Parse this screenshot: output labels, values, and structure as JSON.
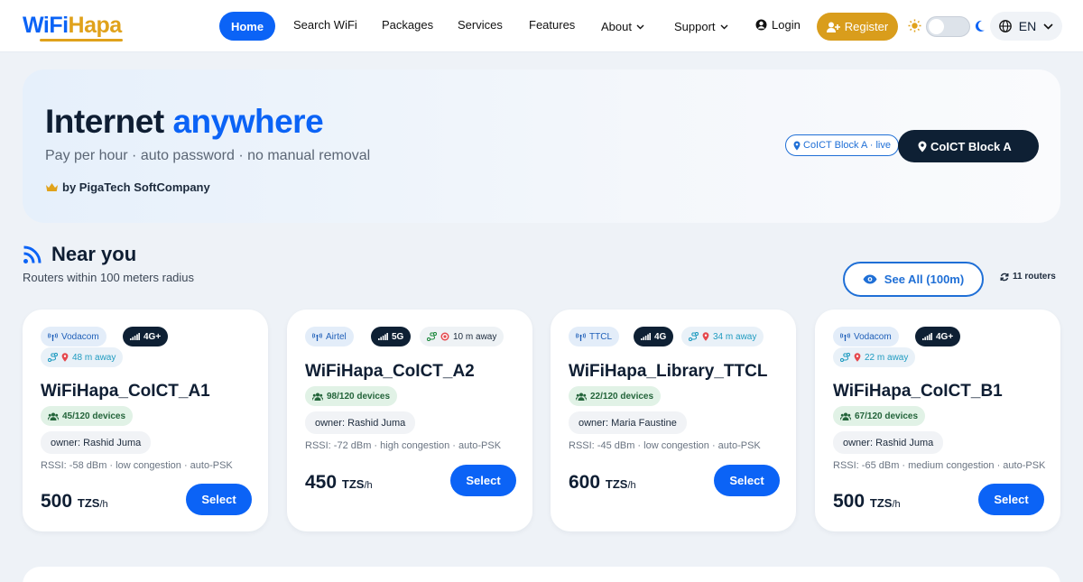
{
  "brand": {
    "logo_a": "WiFi",
    "logo_b": "Hapa"
  },
  "nav": {
    "home": "Home",
    "search": "Search WiFi",
    "packages": "Packages",
    "services": "Services",
    "features": "Features",
    "about": "About",
    "support": "Support",
    "login": "Login",
    "register": "Register",
    "language": "EN"
  },
  "hero": {
    "title_a": "Internet",
    "title_b": "anywhere",
    "subtitle": "Pay per hour · auto password · no manual removal",
    "by": "by PigaTech SoftCompany",
    "location_live": "CoICT Block A · live",
    "location_button": "CoICT Block A"
  },
  "near": {
    "title": "Near you",
    "subtitle": "Routers within 100 meters radius",
    "see_all": "See All (100m)",
    "count": "11 routers"
  },
  "routers": [
    {
      "operator": "Vodacom",
      "network": "4G+",
      "distance": "48 m away",
      "name": "WiFiHapa_CoICT_A1",
      "devices": "45/120 devices",
      "owner": "owner: Rashid Juma",
      "rssi": "RSSI: -58 dBm · low congestion · auto-PSK",
      "price": "500",
      "currency": "TZS",
      "per": "/h",
      "select": "Select"
    },
    {
      "operator": "Airtel",
      "network": "5G",
      "distance": "10 m away",
      "name": "WiFiHapa_CoICT_A2",
      "devices": "98/120 devices",
      "owner": "owner: Rashid Juma",
      "rssi": "RSSI: -72 dBm · high congestion · auto-PSK",
      "price": "450",
      "currency": "TZS",
      "per": "/h",
      "select": "Select"
    },
    {
      "operator": "TTCL",
      "network": "4G",
      "distance": "34 m away",
      "name": "WiFiHapa_Library_TTCL",
      "devices": "22/120 devices",
      "owner": "owner: Maria Faustine",
      "rssi": "RSSI: -45 dBm · low congestion · auto-PSK",
      "price": "600",
      "currency": "TZS",
      "per": "/h",
      "select": "Select"
    },
    {
      "operator": "Vodacom",
      "network": "4G+",
      "distance": "22 m away",
      "name": "WiFiHapa_CoICT_B1",
      "devices": "67/120 devices",
      "owner": "owner: Rashid Juma",
      "rssi": "RSSI: -65 dBm · medium congestion · auto-PSK",
      "price": "500",
      "currency": "TZS",
      "per": "/h",
      "select": "Select"
    }
  ],
  "colors": {
    "primary": "#0b63f6",
    "accent": "#d99d1c",
    "dark": "#0e2034"
  }
}
